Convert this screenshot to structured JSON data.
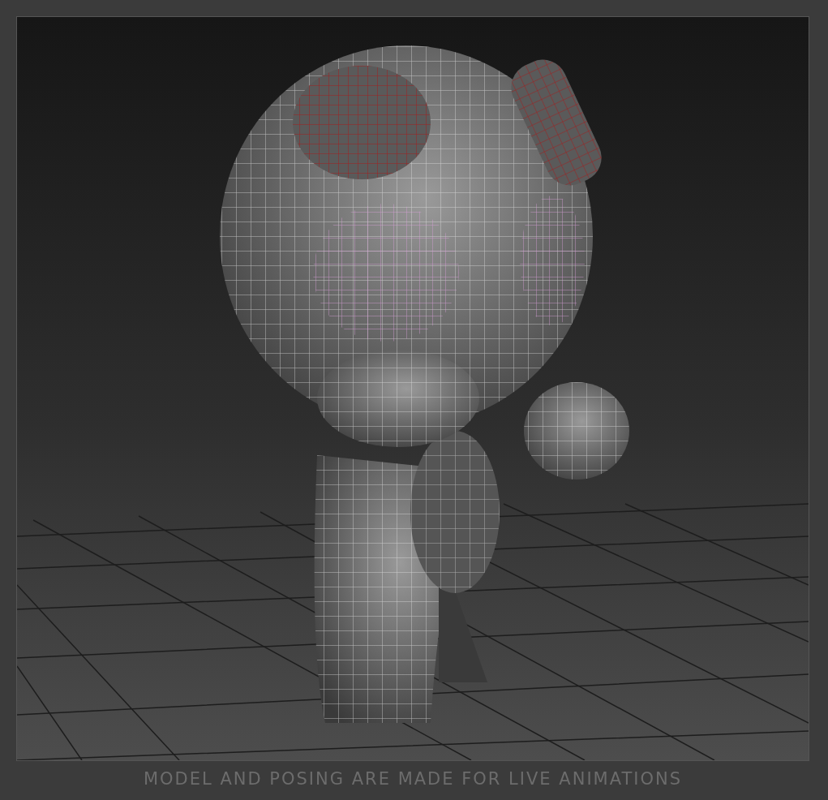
{
  "viewport": {
    "caption": "MODEL AND POSING ARE MADE FOR LIVE ANIMATIONS"
  }
}
